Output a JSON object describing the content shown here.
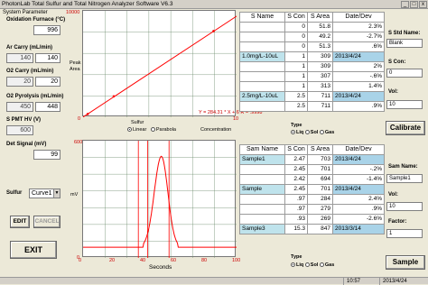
{
  "window": {
    "title": "PhotonLab Total Sulfur and Total Nitrogen Analyzer Software V6.3",
    "minimize": "_",
    "maximize": "□",
    "close": "x"
  },
  "params": {
    "section_title": "System Parameter",
    "oxidation_label": "Oxidation Furnace (°C)",
    "oxidation_value": "996",
    "ar_label": "Ar Carry (mL/min)",
    "ar_set": "140",
    "ar_actual": "140",
    "o2carry_label": "O2 Carry (mL/min)",
    "o2carry_set": "20",
    "o2carry_actual": "20",
    "o2pyro_label": "O2 Pyrolysis (mL/min)",
    "o2pyro_set": "450",
    "o2pyro_actual": "448",
    "pmt_label": "S PMT HV (V)",
    "pmt_value": "600",
    "det_label": "Det Signal (mV)",
    "det_value": "99",
    "sulfur_label": "Sulfur",
    "sulfur_select": "Curve1",
    "edit_label": "EDIT",
    "cancel_label": "CANCEL",
    "exit_label": "EXIT"
  },
  "calib_chart": {
    "ylabel_line1": "Peak",
    "ylabel_line2": "Area",
    "equation": "Y = 284.31 * X + 6 R = .9998",
    "y_max_tick": "10000",
    "x_max_tick": "10",
    "origin_tick": "0",
    "xlabel": "Concentration",
    "type_label": "Sulfur",
    "opt_linear": "Linear",
    "opt_parabola": "Parabola",
    "points": [
      [
        0.3,
        90
      ],
      [
        2.0,
        590
      ],
      [
        8.5,
        2430
      ]
    ],
    "line": [
      [
        0,
        6
      ],
      [
        10,
        2849
      ]
    ]
  },
  "signal_chart": {
    "y_max_tick": "600",
    "y_min_tick": "0",
    "ylabel": "mV",
    "xlabel": "Seconds",
    "x_ticks": [
      "0",
      "20",
      "40",
      "60",
      "80",
      "100"
    ],
    "markers": [
      36,
      42,
      56
    ],
    "peak": {
      "baseline": 55,
      "start": 39,
      "top_t": 51,
      "top_v": 520,
      "end": 62
    }
  },
  "std_table": {
    "headers": [
      "S Name",
      "S Con",
      "S Area",
      "Date/Dev"
    ],
    "rows": [
      [
        "",
        "0",
        "51.8",
        "2.3%"
      ],
      [
        "",
        "0",
        "49.2",
        "-2.7%"
      ],
      [
        "",
        "0",
        "51.3",
        ".6%"
      ],
      [
        "1.0mg/L-10uL",
        "1",
        "309",
        "2013/4/24"
      ],
      [
        "",
        "1",
        "309",
        "2%"
      ],
      [
        "",
        "1",
        "307",
        "-.6%"
      ],
      [
        "",
        "1",
        "313",
        "1.4%"
      ],
      [
        "2.5mg/L-10uL",
        "2.5",
        "711",
        "2013/4/24"
      ],
      [
        "",
        "2.5",
        "711",
        ".9%"
      ]
    ],
    "type_label": "Type",
    "opt_liq": "Liq",
    "opt_sol": "Sol",
    "opt_gas": "Gas"
  },
  "sample_table": {
    "headers": [
      "Sam Name",
      "S Con",
      "S Area",
      "Date/Dev"
    ],
    "rows": [
      [
        "Sample1",
        "2.47",
        "703",
        "2013/4/24"
      ],
      [
        "",
        "2.45",
        "701",
        "-.2%"
      ],
      [
        "",
        "2.42",
        "694",
        "-1.4%"
      ],
      [
        "Sample",
        "2.45",
        "701",
        "2013/4/24"
      ],
      [
        "",
        ".97",
        "284",
        "2.4%"
      ],
      [
        "",
        ".97",
        "279",
        ".9%"
      ],
      [
        "",
        ".93",
        "269",
        "-2.6%"
      ],
      [
        "Sample3",
        "15.3",
        "847",
        "2013/3/14"
      ]
    ],
    "type_label": "Type",
    "opt_liq": "Liq",
    "opt_sol": "Sol",
    "opt_gas": "Gas"
  },
  "right_panel": {
    "std_name_label": "S Std Name:",
    "std_name_value": "Blank",
    "s_con_label": "S Con:",
    "s_con_value": "0",
    "vol_label": "Vol:",
    "vol_value": "10",
    "calibrate_label": "Calibrate",
    "sam_name_label": "Sam Name:",
    "sam_name_value": "Sample1",
    "vol2_label": "Vol:",
    "vol2_value": "10",
    "factor_label": "Factor:",
    "factor_value": "1",
    "sample_label": "Sample"
  },
  "status": {
    "cell1": "",
    "time": "10:57",
    "date": "2013/4/24"
  },
  "colors": {
    "highlight": "#bfe3ec",
    "curve": "#ff0000"
  }
}
